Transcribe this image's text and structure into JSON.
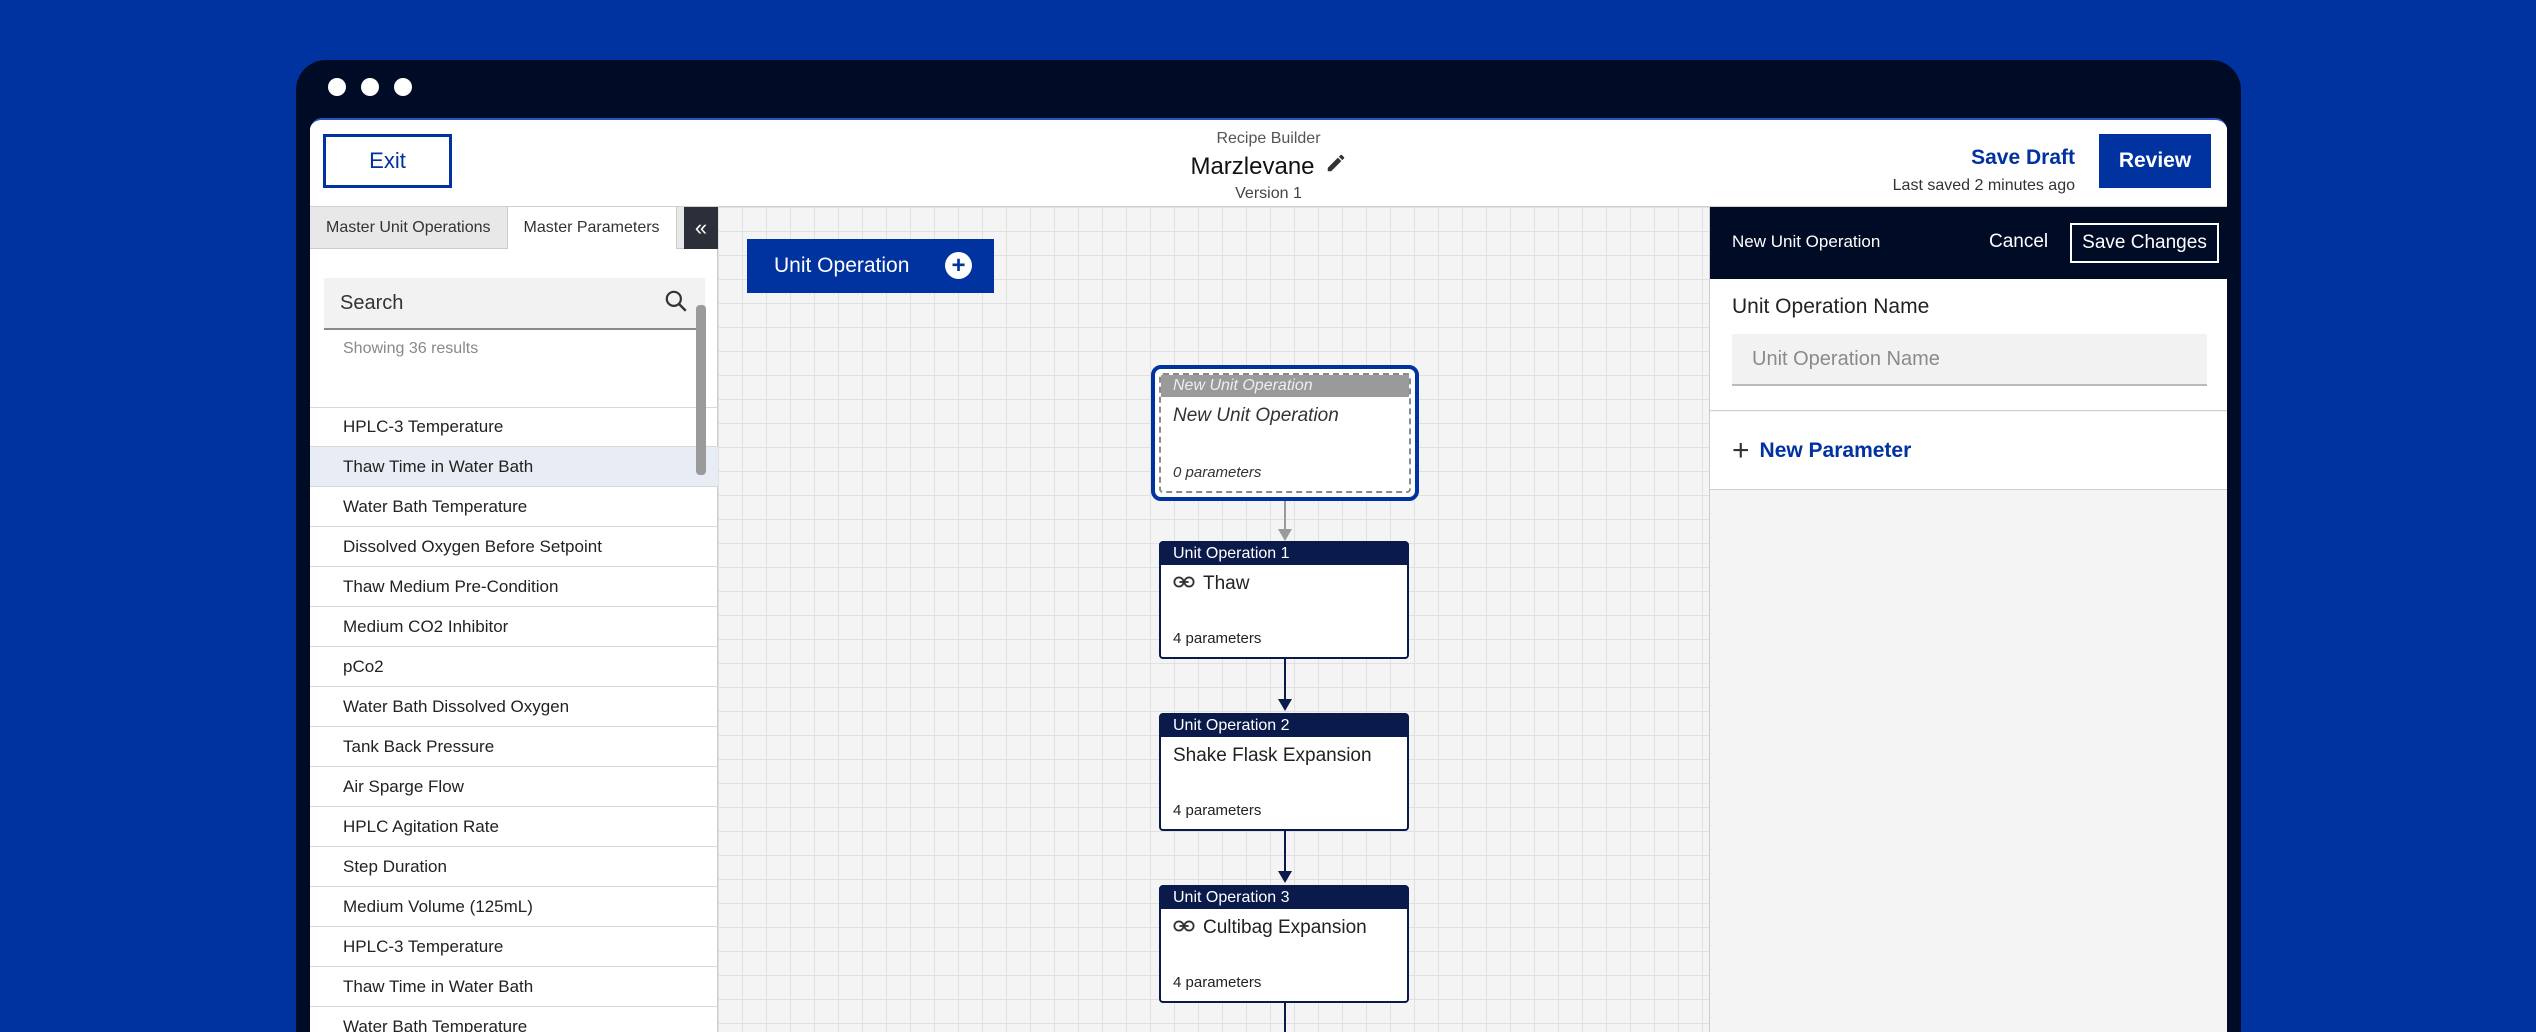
{
  "header": {
    "exit_label": "Exit",
    "subtitle": "Recipe Builder",
    "title": "Marzlevane",
    "version": "Version 1",
    "save_draft_label": "Save Draft",
    "last_saved": "Last saved 2 minutes ago",
    "review_label": "Review"
  },
  "left_panel": {
    "tabs": [
      {
        "label": "Master Unit Operations",
        "active": false
      },
      {
        "label": "Master Parameters",
        "active": true
      }
    ],
    "collapse_icon": "double-chevron-left-icon",
    "search": {
      "placeholder": "Search"
    },
    "results_text": "Showing 36 results",
    "items": [
      {
        "label": "HPLC-3 Temperature"
      },
      {
        "label": "Thaw Time in Water Bath",
        "selected": true
      },
      {
        "label": "Water Bath Temperature"
      },
      {
        "label": "Dissolved Oxygen Before Setpoint"
      },
      {
        "label": "Thaw Medium Pre-Condition"
      },
      {
        "label": "Medium CO2 Inhibitor"
      },
      {
        "label": "pCo2"
      },
      {
        "label": "Water Bath Dissolved Oxygen"
      },
      {
        "label": "Tank Back Pressure"
      },
      {
        "label": "Air Sparge Flow"
      },
      {
        "label": "HPLC Agitation Rate"
      },
      {
        "label": "Step Duration"
      },
      {
        "label": "Medium Volume (125mL)"
      },
      {
        "label": "HPLC-3 Temperature"
      },
      {
        "label": "Thaw Time in Water Bath"
      },
      {
        "label": "Water Bath Temperature"
      }
    ]
  },
  "canvas": {
    "add_button_label": "Unit Operation",
    "new_node": {
      "header": "New Unit Operation",
      "title": "New Unit Operation",
      "params": "0 parameters"
    },
    "nodes": [
      {
        "header": "Unit Operation 1",
        "title": "Thaw",
        "params": "4 parameters",
        "linked": true
      },
      {
        "header": "Unit Operation 2",
        "title": "Shake Flask Expansion",
        "params": "4 parameters",
        "linked": false
      },
      {
        "header": "Unit Operation 3",
        "title": "Cultibag Expansion",
        "params": "4 parameters",
        "linked": true
      }
    ]
  },
  "right_panel": {
    "title": "New Unit Operation",
    "cancel_label": "Cancel",
    "save_label": "Save Changes",
    "field_label": "Unit Operation Name",
    "field_placeholder": "Unit Operation Name",
    "new_parameter_label": "New Parameter"
  },
  "colors": {
    "accent": "#0032a0",
    "dark": "#000b26",
    "node_header": "#0a1a4a"
  }
}
